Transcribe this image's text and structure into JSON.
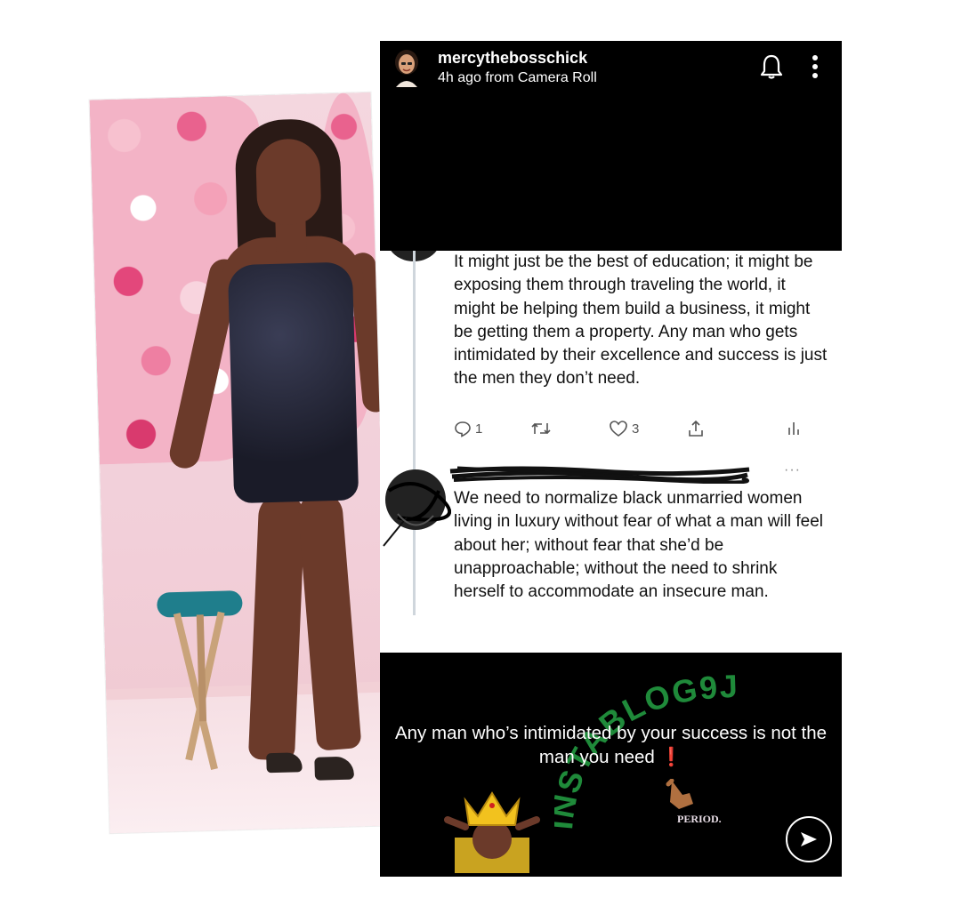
{
  "story": {
    "username": "mercythebosschick",
    "subtitle": "4h ago from Camera Roll",
    "caption_main": "Any man who’s intimidated by your success is not the man you need",
    "caption_emoji": "❗",
    "watermark": "INSTABLOG9JA",
    "sticker_text": "PERIOD."
  },
  "tweet1": {
    "text": "It might just be the best of education; it might be exposing them through traveling the world, it might be helping them build a business, it might be getting them a property. Any man who gets intimidated by their excellence and success is just the men they don’t need.",
    "replies": "1",
    "likes": "3"
  },
  "tweet2": {
    "text": "We need to normalize black unmarried women living in luxury without fear of what a man will feel about her; without fear that she’d be unapproachable; without the need to shrink herself to accommodate an insecure man.",
    "menu": "···"
  },
  "colors": {
    "story_bg": "#000000",
    "tweet_bg": "#ffffff",
    "watermark_green": "#1f8a3a",
    "accent_red": "#e02020"
  }
}
